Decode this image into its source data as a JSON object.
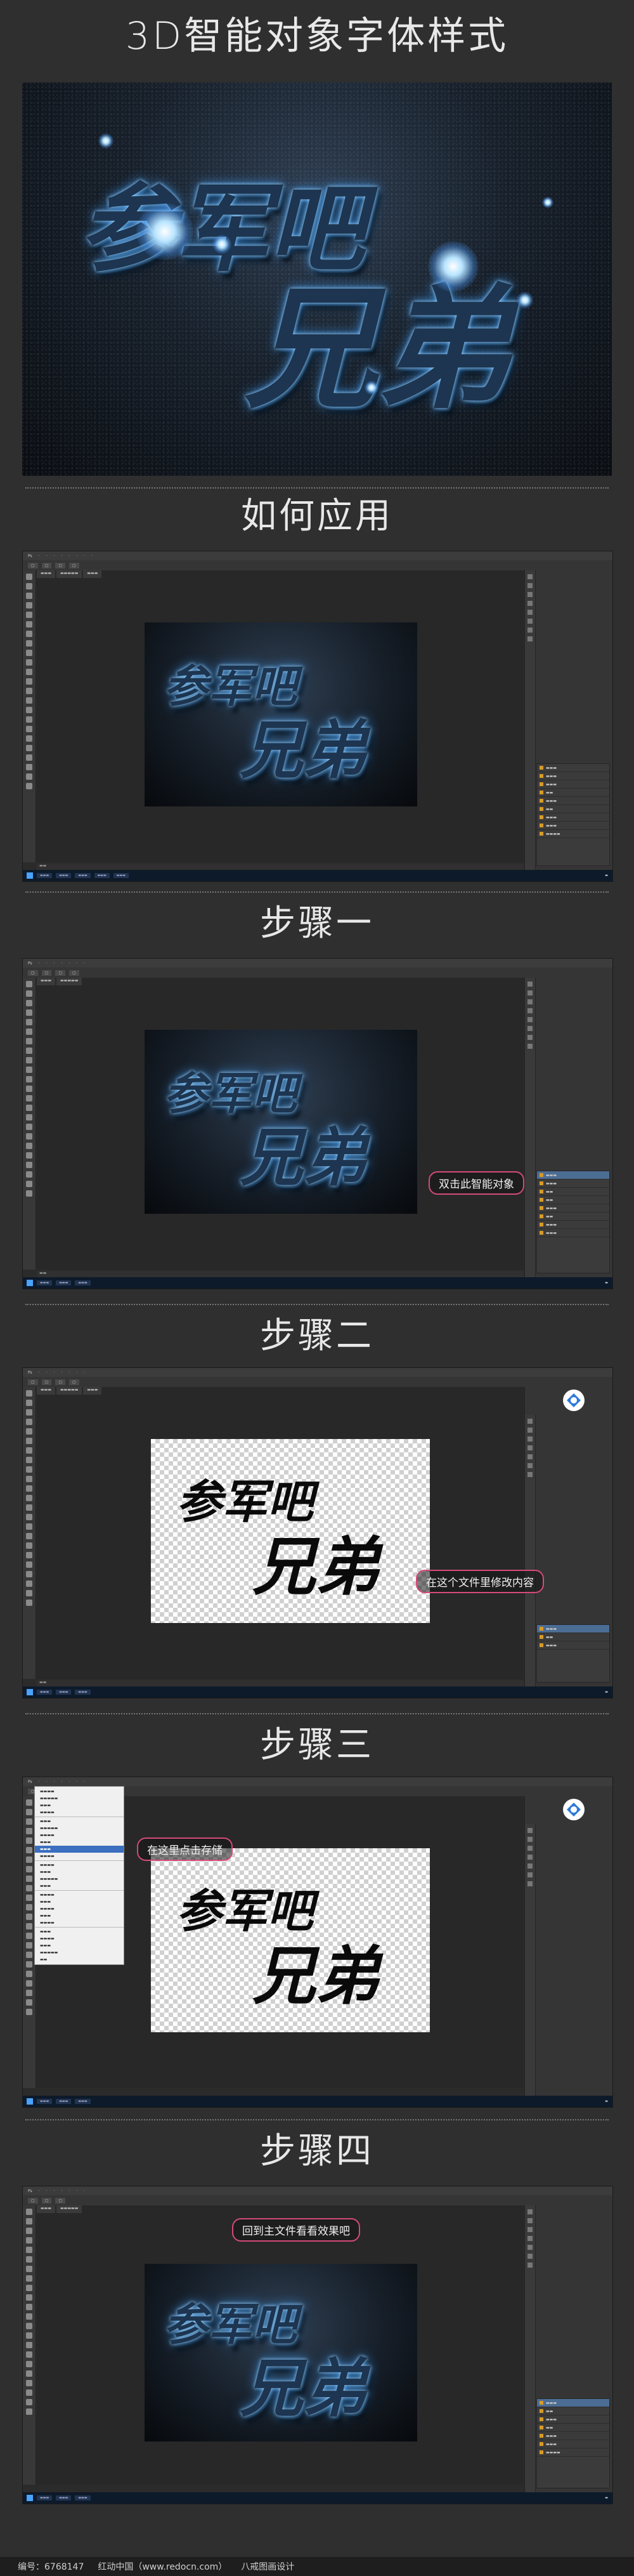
{
  "header": {
    "title": "3D智能对象字体样式"
  },
  "hero": {
    "line1": "参军吧",
    "line2": "兄弟"
  },
  "sections": {
    "how_to": "如何应用",
    "step1": "步骤一",
    "step2": "步骤二",
    "step3": "步骤三",
    "step4": "步骤四"
  },
  "callouts": {
    "step1": "双击此智能对象",
    "step2": "在这个文件里修改内容",
    "step3": "在这里点击存储",
    "step4": "回到主文件看看效果吧"
  },
  "artwork_text": {
    "line1": "参军吧",
    "line2": "兄弟"
  },
  "footer": {
    "id": "编号：6768147",
    "site": "红动中国（www.redocn.com）",
    "author": "八戒图画设计"
  },
  "colors": {
    "background": "#2f2f2f",
    "callout_border": "#d44a7a",
    "glow": "#3b8fe0"
  }
}
